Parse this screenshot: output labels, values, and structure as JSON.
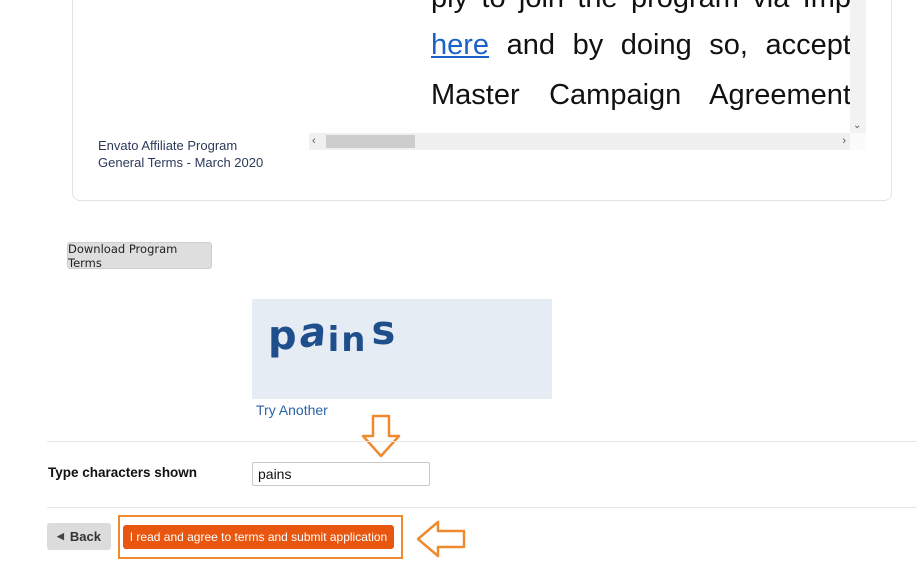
{
  "terms": {
    "caption_line1": "Envato Affiliate Program",
    "caption_line2": "General Terms - March 2020",
    "doc_line1": "ply to join the program via Imp",
    "doc_line2_link": "here",
    "doc_line2_rest": " and by doing so, accept",
    "doc_line3": "Master Campaign Agreement"
  },
  "download_button": {
    "label": "Download Program Terms"
  },
  "captcha": {
    "image_chars": [
      "p",
      "a",
      "in",
      "s"
    ],
    "try_another": "Try Another",
    "field_label": "Type characters shown",
    "input_value": "pains"
  },
  "actions": {
    "back_label": "Back",
    "submit_label": "I read and agree to terms and submit application"
  },
  "colors": {
    "submit_bg": "#e8560f",
    "annotation_orange": "#f08a2e",
    "link_blue": "#2a63a8",
    "captcha_bg": "#e6ecf4"
  },
  "icons": {
    "back": "triangle-left-icon",
    "annotation_down": "arrow-down-icon",
    "annotation_left": "arrow-left-icon"
  }
}
